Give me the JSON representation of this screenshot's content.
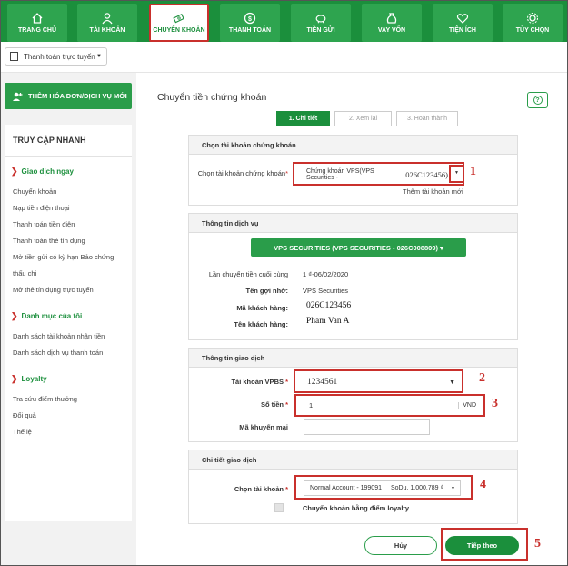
{
  "nav": {
    "items": [
      {
        "label": "TRANG CHỦ",
        "icon": "home-icon"
      },
      {
        "label": "TÀI KHOẢN",
        "icon": "user-icon"
      },
      {
        "label": "CHUYỂN KHOẢN",
        "icon": "transfer-icon"
      },
      {
        "label": "THANH TOÁN",
        "icon": "dollar-icon"
      },
      {
        "label": "TIỀN GỬI",
        "icon": "piggy-bank-icon"
      },
      {
        "label": "VAY VỐN",
        "icon": "money-bag-icon"
      },
      {
        "label": "TIỆN ÍCH",
        "icon": "heart-icon"
      },
      {
        "label": "TÙY CHỌN",
        "icon": "gear-icon"
      }
    ],
    "active_index": 2
  },
  "subbar": {
    "payment_dropdown": "Thanh toán trực tuyến"
  },
  "sidebar": {
    "add_button": "THÊM HÓA ĐƠN/DỊCH VỤ MỚI",
    "quick_access_title": "TRUY CẬP NHANH",
    "groups": [
      {
        "title": "Giao dịch ngay",
        "links": [
          "Chuyển khoản",
          "Nạp tiền điện thoại",
          "Thanh toán tiền điện",
          "Thanh toán thẻ tín dụng",
          "Mở tiền gửi có kỳ hạn Bảo chứng",
          "thấu chi",
          "Mở thẻ tín dụng trực tuyến"
        ]
      },
      {
        "title": "Danh mục của tôi",
        "links": [
          "Danh sách tài khoản nhận tiền",
          "Danh sách dịch vụ thanh toán"
        ]
      },
      {
        "title": "Loyalty",
        "links": [
          "Tra cứu điểm thưởng",
          "Đổi quà",
          "Thể lệ"
        ]
      }
    ]
  },
  "main": {
    "title": "Chuyển tiền chứng khoán",
    "help": "?",
    "steps": [
      "1. Chi tiết",
      "2. Xem lại",
      "3. Hoàn thành"
    ],
    "section1": {
      "heading": "Chọn tài khoản chứng khoán",
      "label": "Chọn tài khoản chứng khoán",
      "value": "Chứng khoán VPS(VPS Securities -",
      "value_account": "026C123456)",
      "add_link": "Thêm tài khoản mới"
    },
    "section2": {
      "heading": "Thông tin dịch vụ",
      "vps_button": "VPS SECURITIES (VPS SECURITIES - 026C008809) ▾",
      "rows": [
        {
          "label": "Lần chuyển tiền cuối cùng",
          "value": "1 ₫-06/02/2020"
        },
        {
          "label": "Tên gợi nhớ:",
          "value": "VPS Securities"
        },
        {
          "label": "Mã khách hàng:",
          "value": "026C123456"
        },
        {
          "label": "Tên khách hàng:",
          "value": "Pham Van A"
        }
      ]
    },
    "section3": {
      "heading": "Thông tin giao dịch",
      "account_label": "Tài khoản VPBS",
      "account_value": "1234561",
      "amount_label": "Số tiền",
      "amount_value": "1",
      "currency": "VND",
      "promo_label": "Mã khuyến mại",
      "promo_value": ""
    },
    "section4": {
      "heading": "Chi tiết giao dịch",
      "account_label": "Chọn tài khoản",
      "account_value": "Normal Account - 199091",
      "balance": "SoDu. 1,000,789 ₫",
      "loyalty_label": "Chuyển khoản bằng điểm loyalty"
    },
    "cancel": "Hủy",
    "next": "Tiếp theo"
  },
  "annotations": [
    "1",
    "2",
    "3",
    "4",
    "5"
  ],
  "colors": {
    "primary": "#1b8f3c",
    "highlight": "#c9302c"
  }
}
